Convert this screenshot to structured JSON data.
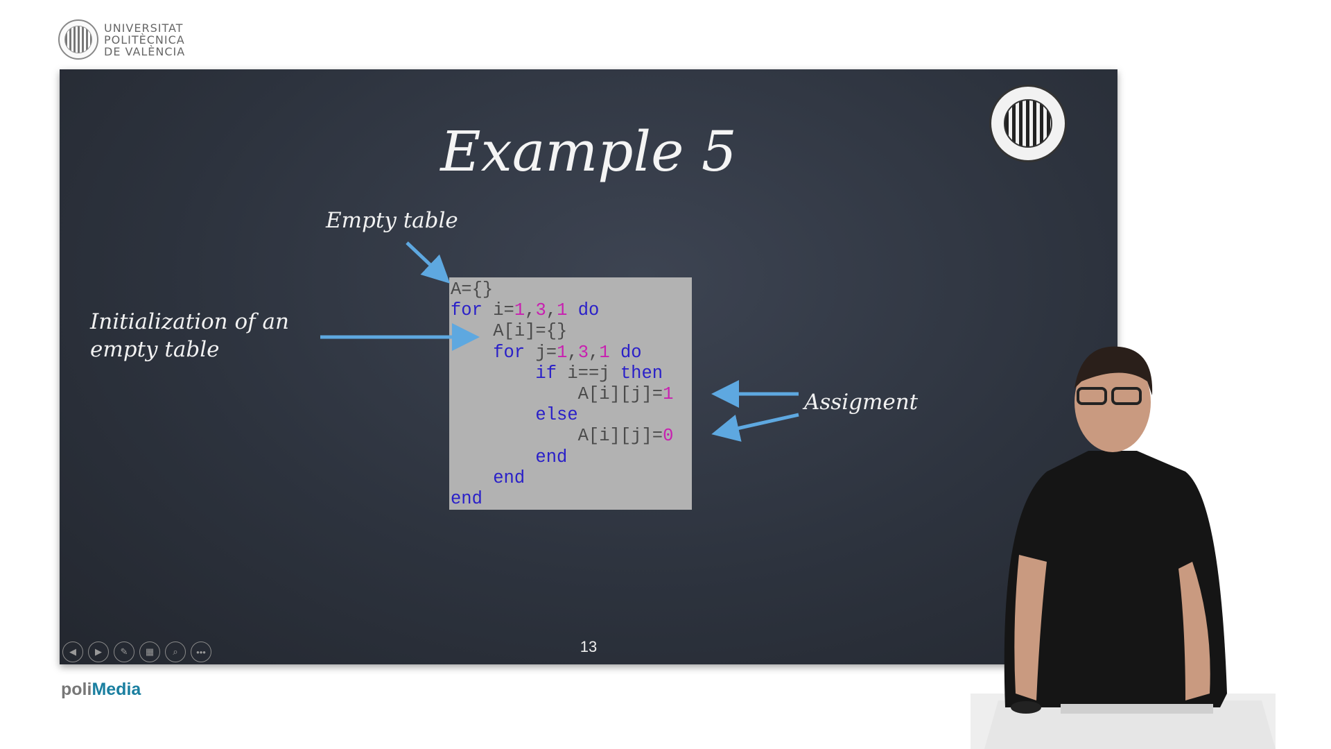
{
  "header": {
    "logo_text": [
      "UNIVERSITAT",
      "POLITÈCNICA",
      "DE VALÈNCIA"
    ]
  },
  "slide": {
    "title": "Example 5",
    "annotations": {
      "empty_table": "Empty table",
      "initialization": [
        "Initialization of an",
        "empty table"
      ],
      "assignment": "Assigment"
    },
    "code": [
      [
        [
          "t",
          "A={}"
        ]
      ],
      [
        [
          "k",
          "for"
        ],
        [
          "t",
          " i="
        ],
        [
          "n",
          "1"
        ],
        [
          "t",
          ","
        ],
        [
          "n",
          "3"
        ],
        [
          "t",
          ","
        ],
        [
          "n",
          "1"
        ],
        [
          "t",
          " "
        ],
        [
          "k",
          "do"
        ]
      ],
      [
        [
          "t",
          "    A[i]={}"
        ]
      ],
      [
        [
          "t",
          "    "
        ],
        [
          "k",
          "for"
        ],
        [
          "t",
          " j="
        ],
        [
          "n",
          "1"
        ],
        [
          "t",
          ","
        ],
        [
          "n",
          "3"
        ],
        [
          "t",
          ","
        ],
        [
          "n",
          "1"
        ],
        [
          "t",
          " "
        ],
        [
          "k",
          "do"
        ]
      ],
      [
        [
          "t",
          "        "
        ],
        [
          "k",
          "if"
        ],
        [
          "t",
          " i==j "
        ],
        [
          "k",
          "then"
        ]
      ],
      [
        [
          "t",
          "            A[i][j]="
        ],
        [
          "n",
          "1"
        ]
      ],
      [
        [
          "t",
          "        "
        ],
        [
          "k",
          "else"
        ]
      ],
      [
        [
          "t",
          "            A[i][j]="
        ],
        [
          "n",
          "0"
        ]
      ],
      [
        [
          "t",
          "        "
        ],
        [
          "k",
          "end"
        ]
      ],
      [
        [
          "t",
          "    "
        ],
        [
          "k",
          "end"
        ]
      ],
      [
        [
          "k",
          "end"
        ]
      ]
    ],
    "page_number": "13",
    "controls": [
      "previous",
      "next",
      "pen",
      "slides",
      "zoom",
      "more"
    ]
  },
  "footer": {
    "brand_part1": "poli",
    "brand_part2": "Media"
  },
  "colors": {
    "accent": "#1a7fa0",
    "arrow": "#5ea8e0",
    "keyword": "#2a20c8",
    "number": "#c81fb0"
  }
}
